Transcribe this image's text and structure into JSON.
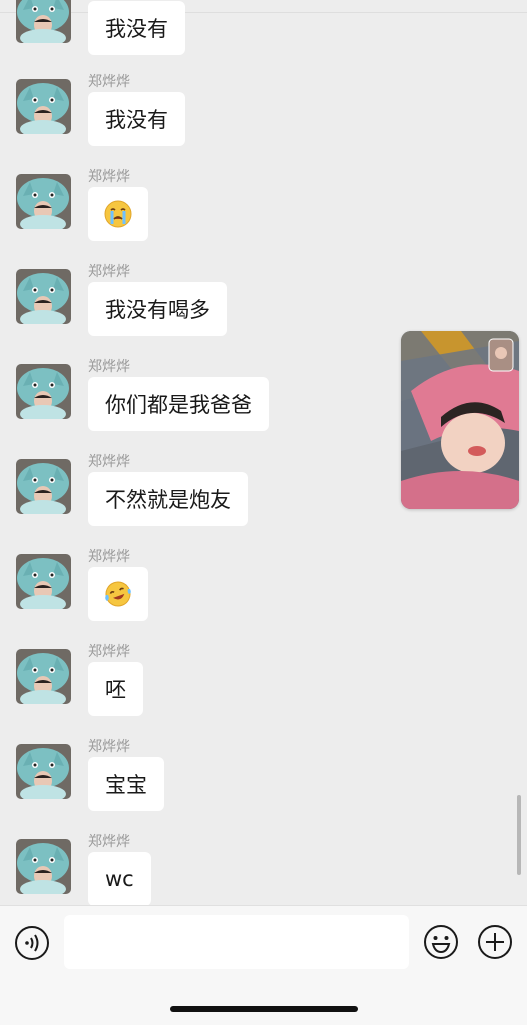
{
  "chat": {
    "sender_name": "郑烨烨",
    "messages": [
      {
        "type": "text",
        "text": "我没有"
      },
      {
        "type": "text",
        "text": "我没有"
      },
      {
        "type": "emoji",
        "emoji": "crying-face"
      },
      {
        "type": "text",
        "text": "我没有喝多"
      },
      {
        "type": "text",
        "text": "你们都是我爸爸"
      },
      {
        "type": "text",
        "text": "不然就是炮友"
      },
      {
        "type": "emoji",
        "emoji": "laughing-tears-face"
      },
      {
        "type": "text",
        "text": "呸"
      },
      {
        "type": "text",
        "text": "宝宝"
      },
      {
        "type": "text",
        "text": "wc"
      }
    ]
  },
  "input": {
    "placeholder": "",
    "value": ""
  },
  "icons": {
    "voice": "voice-wave-icon",
    "emoji": "smiley-icon",
    "plus": "plus-circle-icon"
  },
  "colors": {
    "background": "#ededed",
    "bubble": "#ffffff",
    "sender": "#9a9a9a"
  }
}
